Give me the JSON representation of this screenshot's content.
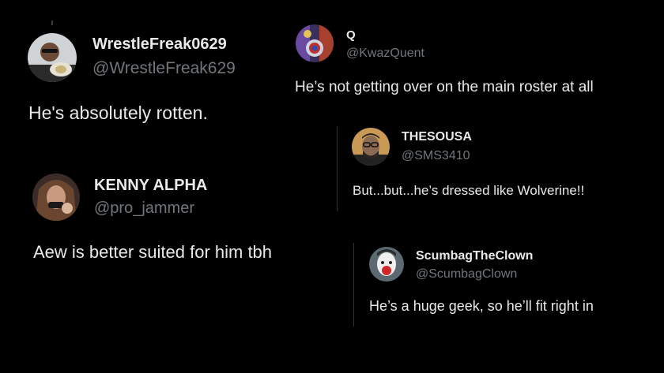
{
  "posts": [
    {
      "name": "WrestleFreak0629",
      "handle": "@WrestleFreak629",
      "text": "He's absolutely rotten.",
      "avatar_icon": "user-avatar-icon"
    },
    {
      "name": "Q",
      "handle": "@KwazQuent",
      "text": "He’s not getting over on the main roster at all",
      "avatar_icon": "user-avatar-icon"
    },
    {
      "name": "THESOUSA",
      "handle": "@SMS3410",
      "text": "But...but...he’s dressed like Wolverine!!",
      "avatar_icon": "user-avatar-icon"
    },
    {
      "name": "KENNY ALPHA",
      "handle": "@pro_jammer",
      "text": "Aew is better suited for him tbh",
      "avatar_icon": "user-avatar-icon"
    },
    {
      "name": "ScumbagTheClown",
      "handle": "@ScumbagClown",
      "text": "He’s a huge geek, so he’ll fit right in",
      "avatar_icon": "user-avatar-icon"
    }
  ],
  "colors": {
    "background": "#000000",
    "primary_text": "#e7e9ea",
    "secondary_text": "#71767b",
    "divider": "#2f3336"
  }
}
